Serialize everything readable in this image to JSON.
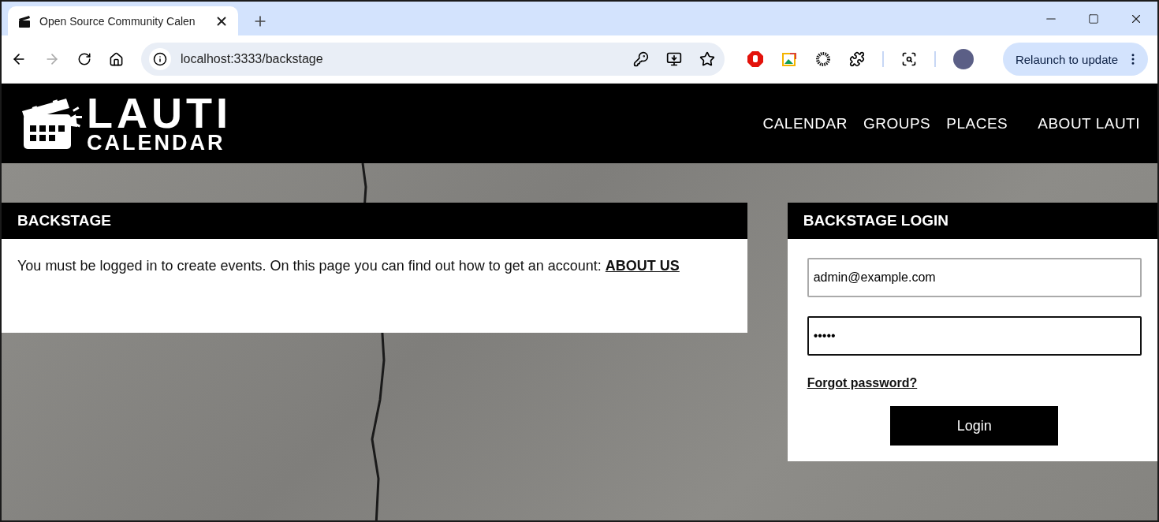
{
  "browser": {
    "tab": {
      "title": "Open Source Community Calen",
      "selected": true
    },
    "address": "localhost:3333/backstage",
    "relaunch": "Relaunch to update"
  },
  "site": {
    "logo": {
      "title": "LAUTI",
      "subtitle": "CALENDAR"
    },
    "nav": [
      "CALENDAR",
      "GROUPS",
      "PLACES",
      "ABOUT LAUTI"
    ]
  },
  "backstage": {
    "title": "BACKSTAGE",
    "message": "You must be logged in to create events. On this page you can find out how to get an account:",
    "link": "ABOUT US"
  },
  "login": {
    "title": "BACKSTAGE LOGIN",
    "email": "admin@example.com",
    "password": "•••••",
    "forgot": "Forgot password?",
    "button": "Login"
  }
}
